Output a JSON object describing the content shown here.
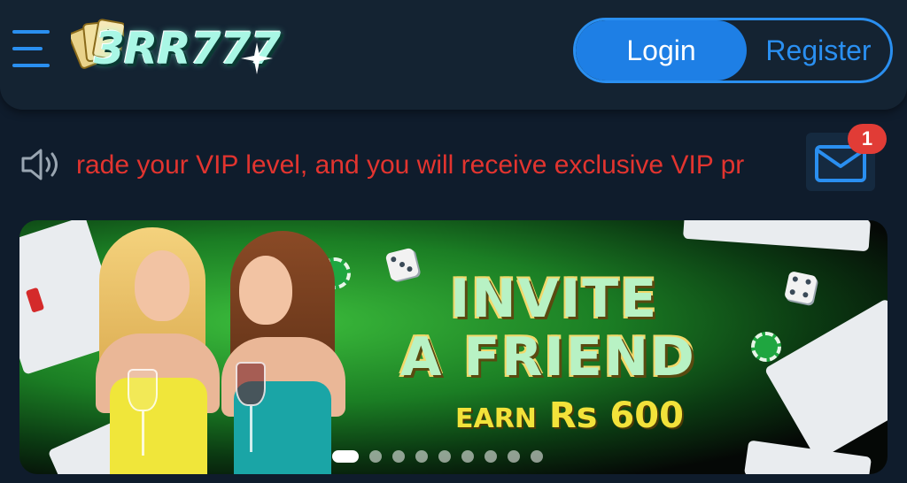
{
  "header": {
    "logo_text": "3RR777",
    "login_label": "Login",
    "register_label": "Register"
  },
  "notice": {
    "marquee_text": "rade your VIP level, and you will receive exclusive VIP pr",
    "mail_badge_count": "1"
  },
  "banner": {
    "line1": "INVITE",
    "line2": "A FRIEND",
    "earn_prefix": "EARN",
    "earn_currency": "Rs",
    "earn_amount": "600",
    "slide_count": 9,
    "active_slide": 1
  },
  "colors": {
    "background": "#0f1c2c",
    "header": "#142332",
    "accent_blue": "#1e7fe5",
    "marquee_red": "#e2342f",
    "badge_red": "#e13c36"
  },
  "icons": [
    "menu-icon",
    "speaker-icon",
    "mail-icon"
  ]
}
